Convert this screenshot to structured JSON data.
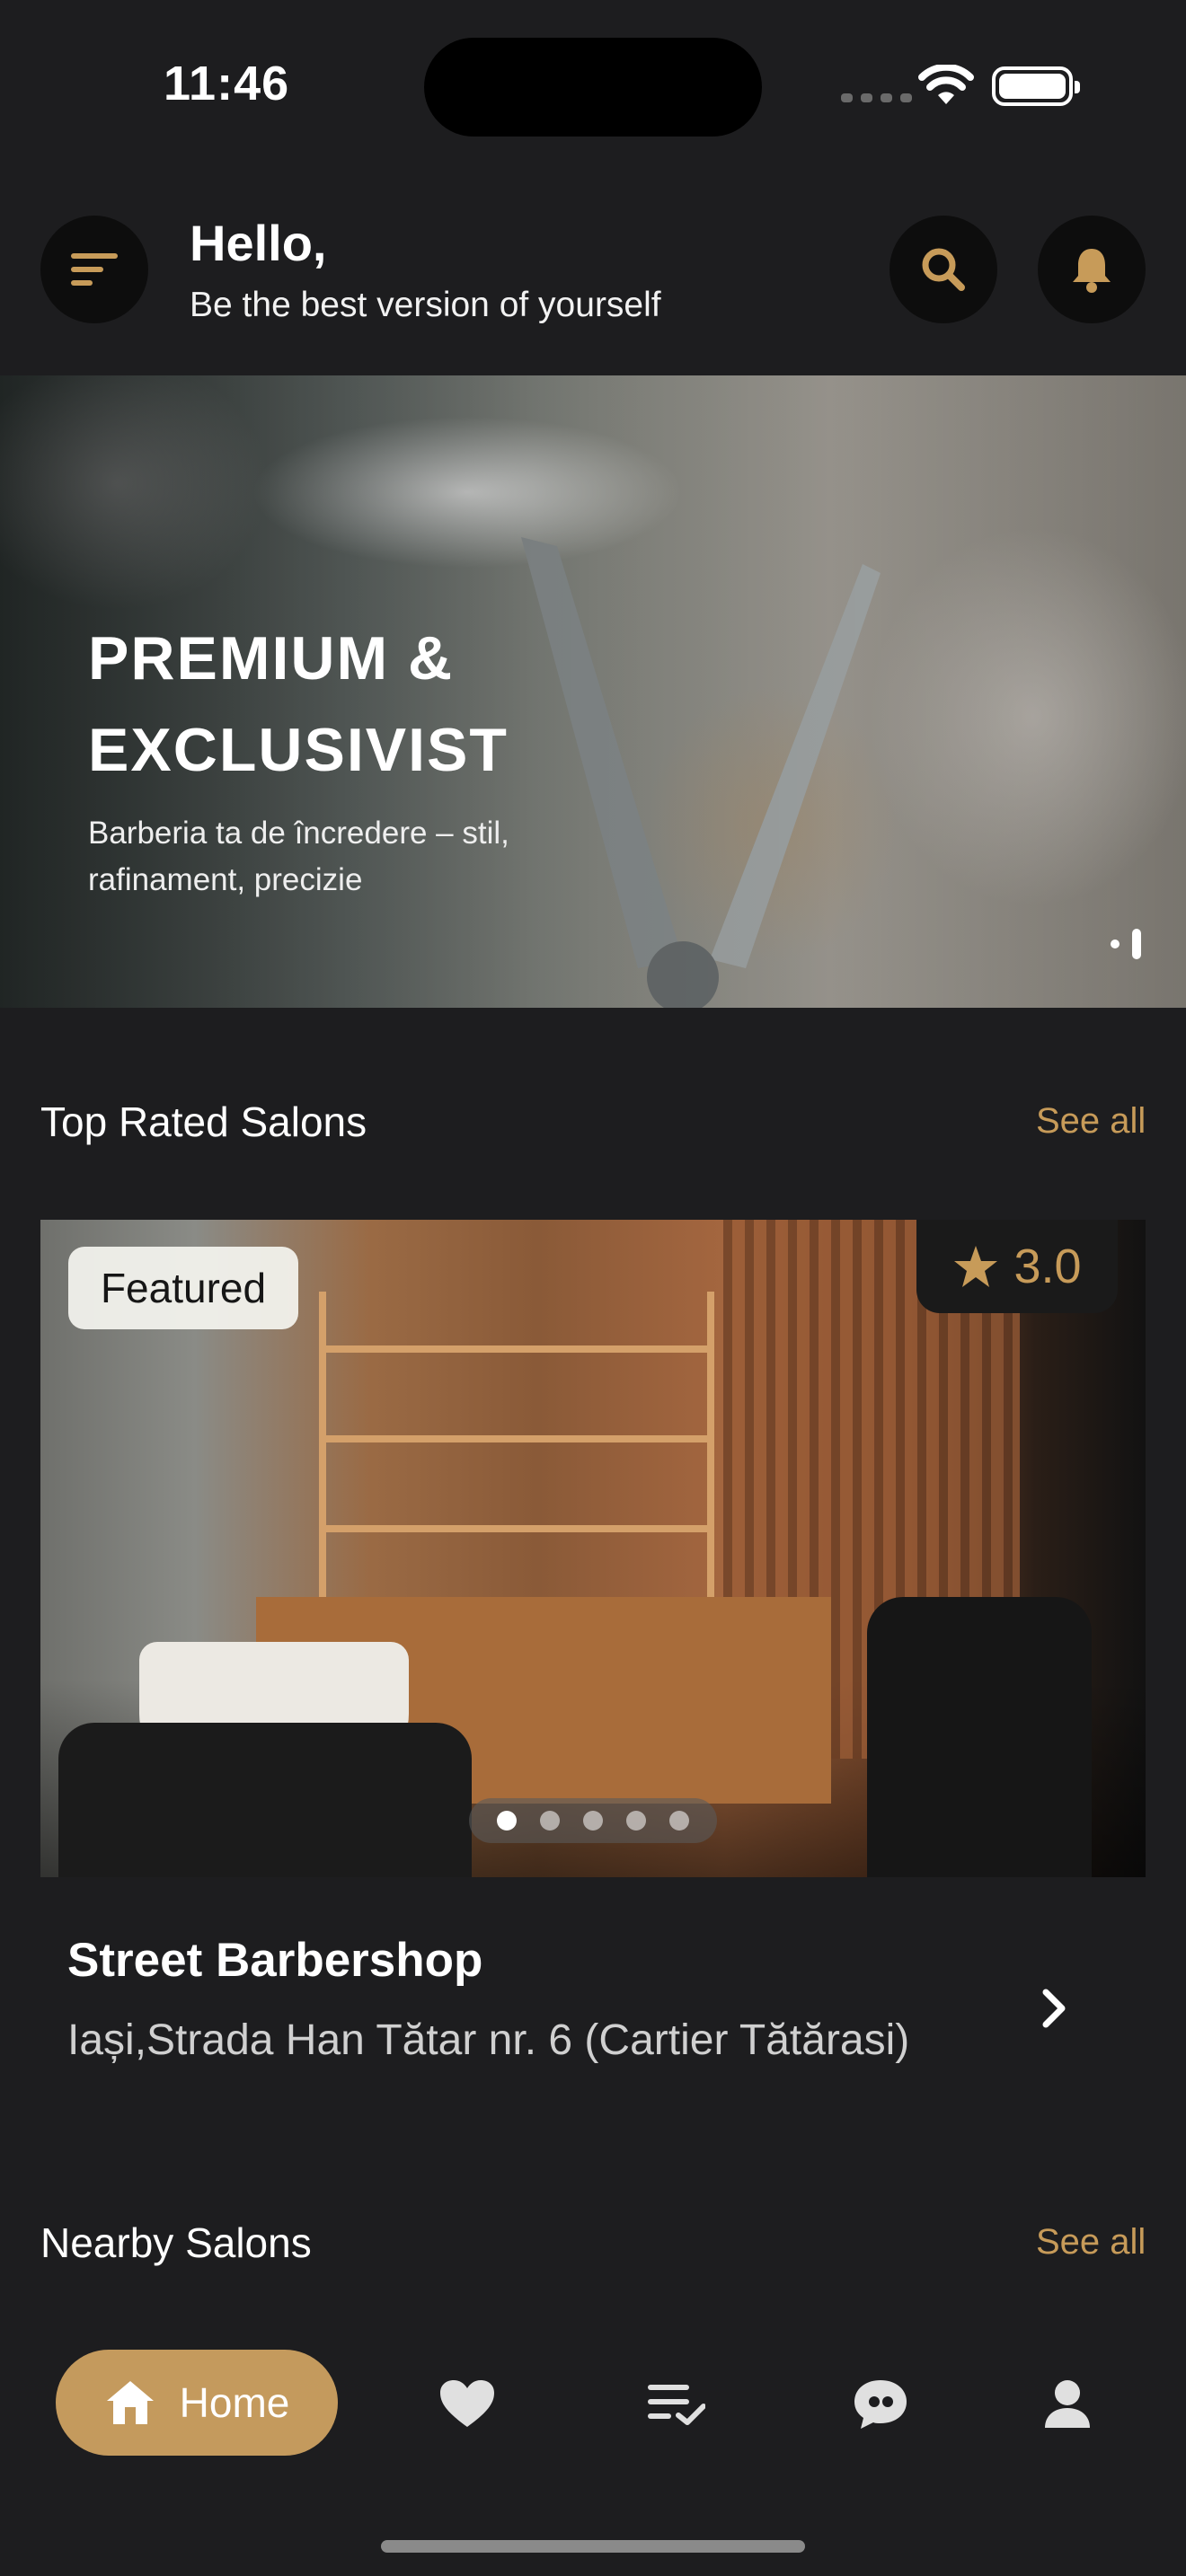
{
  "status_bar": {
    "time": "11:46"
  },
  "header": {
    "menu_icon": "menu-lines-icon",
    "greeting": "Hello,",
    "subtitle": "Be the best version of yourself",
    "search_icon": "search-icon",
    "notification_icon": "bell-icon"
  },
  "hero": {
    "title": "PREMIUM & EXCLUSIVIST",
    "subtitle": "Barberia ta de încredere – stil, rafinament, precizie"
  },
  "top_rated": {
    "title": "Top Rated Salons",
    "see_all": "See all",
    "salon": {
      "badge": "Featured",
      "rating": "3.0",
      "name": "Street Barbershop",
      "address": "Iași,Strada Han Tătar nr. 6 (Cartier Tătărasi)"
    }
  },
  "nearby": {
    "title": "Nearby Salons",
    "see_all": "See all"
  },
  "bottom_nav": {
    "home_label": "Home",
    "items": [
      "home-icon",
      "heart-icon",
      "checklist-icon",
      "chat-icon",
      "profile-icon"
    ]
  },
  "colors": {
    "accent": "#c79b59",
    "background": "#1d1d1f",
    "button_bg": "#0d0d0d"
  }
}
